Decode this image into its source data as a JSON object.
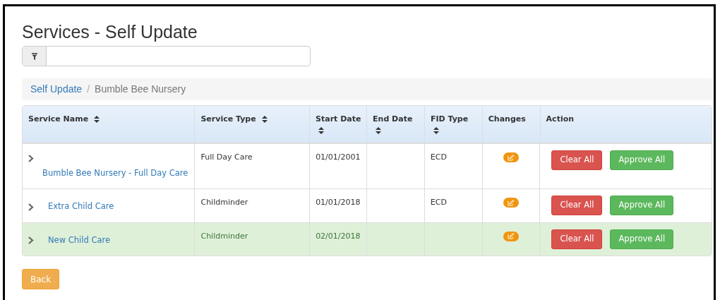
{
  "title": "Services - Self Update",
  "breadcrumb_separator": "/",
  "breadcrumb": [
    {
      "label": "Self Update",
      "kind": "link"
    },
    {
      "label": "Bumble Bee Nursery",
      "kind": "current"
    }
  ],
  "table": {
    "columns": [
      {
        "label": "Service Name",
        "sortable": true
      },
      {
        "label": "Service Type",
        "sortable": true
      },
      {
        "label": "Start Date",
        "sortable": true
      },
      {
        "label": "End Date",
        "sortable": true
      },
      {
        "label": "FID Type",
        "sortable": true
      },
      {
        "label": "Changes",
        "sortable": false
      },
      {
        "label": "Action",
        "sortable": false
      }
    ],
    "rows": [
      {
        "name": "Bumble Bee Nursery - Full Day Care",
        "type": "Full Day Care",
        "start": "01/01/2001",
        "fid": "ECD",
        "highlighted": false,
        "actions": [
          "Clear All",
          "Approve All"
        ]
      },
      {
        "name": "Extra Child Care",
        "type": "Childminder",
        "start": "01/01/2018",
        "fid": "ECD",
        "highlighted": false,
        "actions": [
          "Clear All",
          "Approve All"
        ]
      },
      {
        "name": "New Child Care",
        "type": "Childminder",
        "start": "02/01/2018",
        "highlighted": true,
        "actions": [
          "Clear All",
          "Approve All"
        ]
      }
    ]
  },
  "back_button": "Back"
}
